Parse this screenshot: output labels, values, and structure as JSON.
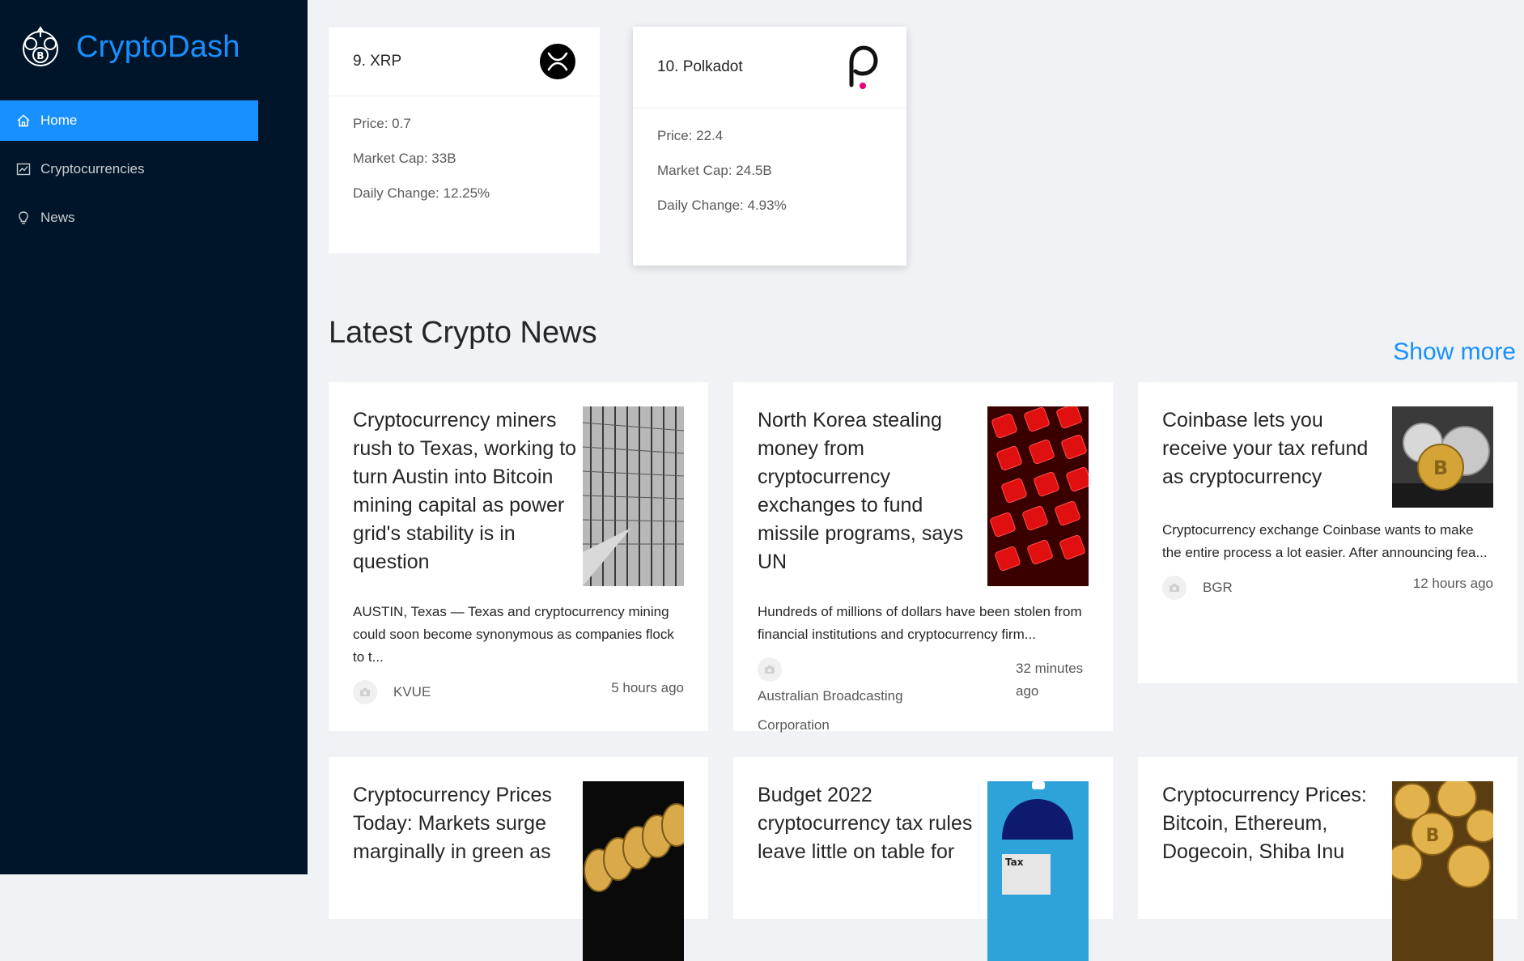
{
  "brand": {
    "title": "CryptoDash",
    "logo_icon": "bitcoin-globe-icon"
  },
  "colors": {
    "sidebar_bg": "#001529",
    "accent": "#1890ff",
    "page_bg": "#f0f2f5"
  },
  "menu": [
    {
      "label": "Home",
      "icon": "home-icon",
      "active": true
    },
    {
      "label": "Cryptocurrencies",
      "icon": "fund-icon",
      "active": false
    },
    {
      "label": "News",
      "icon": "bulb-icon",
      "active": false
    }
  ],
  "coins": [
    {
      "name": "9. XRP",
      "icon": "xrp-icon",
      "price": "Price: 0.7",
      "market_cap": "Market Cap: 33B",
      "daily_change": "Daily Change: 12.25%"
    },
    {
      "name": "10. Polkadot",
      "icon": "polkadot-icon",
      "price": "Price: 22.4",
      "market_cap": "Market Cap: 24.5B",
      "daily_change": "Daily Change: 4.93%"
    }
  ],
  "news_section": {
    "title": "Latest Crypto News",
    "show_more": "Show more"
  },
  "news": [
    {
      "title": "Cryptocurrency miners rush to Texas, working to turn Austin into Bitcoin mining capital as power grid's stability is in question",
      "description": "AUSTIN, Texas — Texas and cryptocurrency mining could soon become synonymous as companies flock to t...",
      "provider": "KVUE",
      "time": "5 hours ago",
      "image": "server-rack-photo"
    },
    {
      "title": "North Korea stealing money from cryptocurrency exchanges to fund missile programs, says UN",
      "description": "Hundreds of millions of dollars have been stolen from financial institutions and cryptocurrency firm...",
      "provider": "Australian Broadcasting Corporation",
      "time": "32 minutes ago",
      "image": "red-keyboard-photo"
    },
    {
      "title": "Coinbase lets you receive your tax refund as cryptocurrency",
      "description": "Cryptocurrency exchange Coinbase wants to make the entire process a lot easier. After announcing fea...",
      "provider": "BGR",
      "time": "12 hours ago",
      "image": "coins-photo"
    },
    {
      "title": "Cryptocurrency Prices Today: Markets surge marginally in green as",
      "image": "gold-coins-photo"
    },
    {
      "title": "Budget 2022 cryptocurrency tax rules leave little on table for",
      "image": "tax-umbrella-photo"
    },
    {
      "title": "Cryptocurrency Prices: Bitcoin, Ethereum, Dogecoin, Shiba Inu",
      "image": "bitcoin-pile-photo"
    }
  ]
}
